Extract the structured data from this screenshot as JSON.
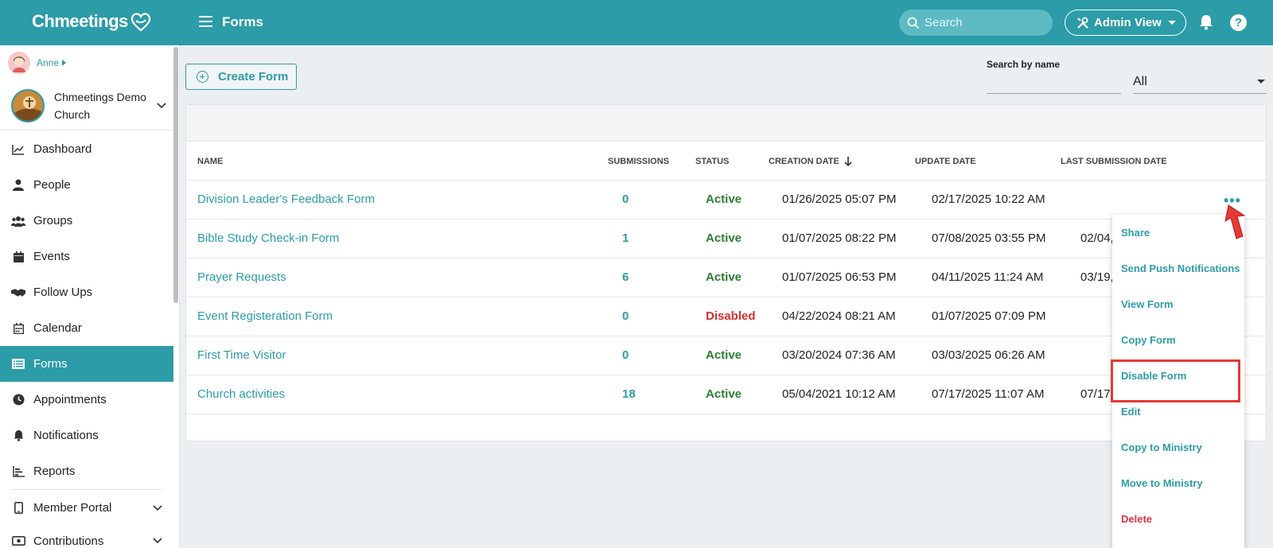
{
  "app": {
    "name": "Chmeetings",
    "page_title": "Forms"
  },
  "topbar": {
    "search_placeholder": "Search",
    "admin_view_label": "Admin View"
  },
  "sidebar": {
    "user_name": "Anne",
    "church_name": "Chmeetings Demo Church",
    "items": [
      {
        "label": "Dashboard",
        "icon": "chart-line-icon"
      },
      {
        "label": "People",
        "icon": "person-icon"
      },
      {
        "label": "Groups",
        "icon": "users-icon"
      },
      {
        "label": "Events",
        "icon": "calendar-icon"
      },
      {
        "label": "Follow Ups",
        "icon": "handshake-icon"
      },
      {
        "label": "Calendar",
        "icon": "calendar-grid-icon"
      },
      {
        "label": "Forms",
        "icon": "list-icon",
        "active": true
      },
      {
        "label": "Appointments",
        "icon": "clock-icon"
      },
      {
        "label": "Notifications",
        "icon": "bell-icon"
      },
      {
        "label": "Reports",
        "icon": "bar-chart-icon"
      },
      {
        "label": "Member Portal",
        "icon": "phone-icon"
      },
      {
        "label": "Contributions",
        "icon": "money-icon"
      }
    ]
  },
  "toolbar": {
    "create_label": "Create Form",
    "search_by_name_label": "Search by name",
    "search_by_name_value": "",
    "status_filter_value": "All"
  },
  "table": {
    "headers": {
      "name": "NAME",
      "submissions": "SUBMISSIONS",
      "status": "STATUS",
      "creation_date": "CREATION DATE",
      "update_date": "UPDATE DATE",
      "last_submission_date": "LAST SUBMISSION DATE"
    },
    "rows": [
      {
        "name": "Division Leader's Feedback Form",
        "submissions": "0",
        "status": "Active",
        "created": "01/26/2025 05:07 PM",
        "updated": "02/17/2025 10:22 AM",
        "last": ""
      },
      {
        "name": "Bible Study Check-in Form",
        "submissions": "1",
        "status": "Active",
        "created": "01/07/2025 08:22 PM",
        "updated": "07/08/2025 03:55 PM",
        "last": "02/04,"
      },
      {
        "name": "Prayer Requests",
        "submissions": "6",
        "status": "Active",
        "created": "01/07/2025 06:53 PM",
        "updated": "04/11/2025 11:24 AM",
        "last": "03/19,"
      },
      {
        "name": "Event Registeration Form",
        "submissions": "0",
        "status": "Disabled",
        "created": "04/22/2024 08:21 AM",
        "updated": "01/07/2025 07:09 PM",
        "last": ""
      },
      {
        "name": "First Time Visitor",
        "submissions": "0",
        "status": "Active",
        "created": "03/20/2024 07:36 AM",
        "updated": "03/03/2025 06:26 AM",
        "last": ""
      },
      {
        "name": "Church activities",
        "submissions": "18",
        "status": "Active",
        "created": "05/04/2021 10:12 AM",
        "updated": "07/17/2025 11:07 AM",
        "last": "07/17"
      }
    ]
  },
  "row_menu": {
    "items": [
      "Share",
      "Send Push Notifications",
      "View Form",
      "Copy Form",
      "Disable Form",
      "Edit",
      "Copy to Ministry",
      "Move to Ministry",
      "Delete"
    ]
  },
  "colors": {
    "brand": "#2c9ca8",
    "active": "#2e7d32",
    "disabled": "#d32f2f",
    "delete": "#e0334a",
    "highlight": "#e53935"
  }
}
